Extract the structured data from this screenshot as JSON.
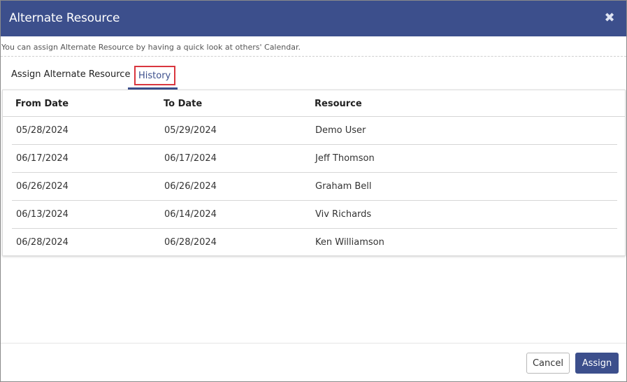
{
  "dialog": {
    "title": "Alternate Resource",
    "close_icon": "close-icon",
    "subtitle": "You can assign Alternate Resource by having a quick look at others' Calendar."
  },
  "tabs": [
    {
      "label": "Assign Alternate Resource",
      "active": false
    },
    {
      "label": "History",
      "active": true
    }
  ],
  "table": {
    "headers": [
      "From Date",
      "To Date",
      "Resource"
    ],
    "rows": [
      {
        "from": "05/28/2024",
        "to": "05/29/2024",
        "resource": "Demo User"
      },
      {
        "from": "06/17/2024",
        "to": "06/17/2024",
        "resource": "Jeff Thomson"
      },
      {
        "from": "06/26/2024",
        "to": "06/26/2024",
        "resource": "Graham Bell"
      },
      {
        "from": "06/13/2024",
        "to": "06/14/2024",
        "resource": "Viv Richards"
      },
      {
        "from": "06/28/2024",
        "to": "06/28/2024",
        "resource": "Ken Williamson"
      }
    ]
  },
  "footer": {
    "cancel_label": "Cancel",
    "assign_label": "Assign"
  },
  "colors": {
    "header_bg": "#3c4f8c",
    "accent": "#3c4f8c",
    "highlight_border": "#d9363e"
  }
}
